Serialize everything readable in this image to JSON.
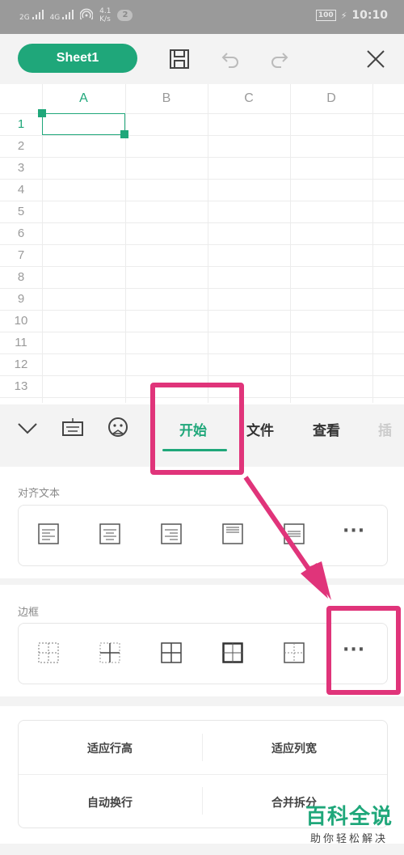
{
  "status_bar": {
    "network_1": "2G",
    "network_2": "4G",
    "speed_value": "4.1",
    "speed_unit": "K/s",
    "notif_count": "2",
    "battery": "100",
    "time": "10:10"
  },
  "title_bar": {
    "sheet_name": "Sheet1",
    "icons": [
      "save-icon",
      "undo-icon",
      "redo-icon",
      "close-icon"
    ]
  },
  "grid": {
    "columns": [
      "A",
      "B",
      "C",
      "D"
    ],
    "rows": [
      "1",
      "2",
      "3",
      "4",
      "5",
      "6",
      "7",
      "8",
      "9",
      "10",
      "11",
      "12",
      "13"
    ],
    "selected_cell": "A1"
  },
  "tab_bar": {
    "tabs": [
      "开始",
      "文件",
      "查看",
      "插"
    ],
    "active_tab": "开始"
  },
  "sections": {
    "align": {
      "title": "对齐文本",
      "options": [
        "align-left-icon",
        "align-center-icon",
        "align-right-icon",
        "align-top-icon",
        "align-middle-icon"
      ],
      "more": "···"
    },
    "border": {
      "title": "边框",
      "options": [
        "border-dashed-icon",
        "border-inner-icon",
        "border-all-icon",
        "border-thick-outer-icon",
        "border-outer-dashed-icon"
      ],
      "more": "···"
    },
    "actions": {
      "row1": [
        "适应行高",
        "适应列宽"
      ],
      "row2": [
        "自动换行",
        "合并拆分"
      ]
    }
  },
  "watermark": {
    "main": "百科全说",
    "sub": "助你轻松解决"
  },
  "colors": {
    "accent": "#1fa77a",
    "highlight": "#e0347a"
  }
}
